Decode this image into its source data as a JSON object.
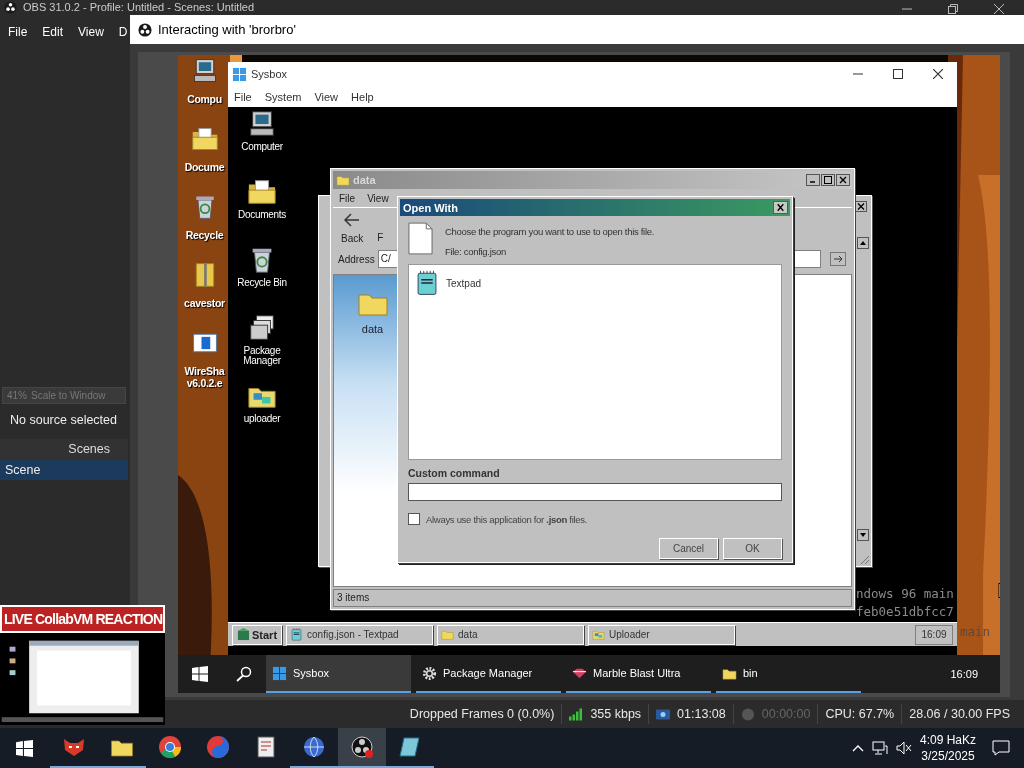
{
  "obs": {
    "title": "OBS 31.0.2 - Profile: Untitled - Scenes: Untitled",
    "menu": [
      "File",
      "Edit",
      "View",
      "D"
    ],
    "scale": {
      "percent": "41%",
      "label": "Scale to Window"
    },
    "no_source": "No source selected",
    "scenes": {
      "header": "Scenes",
      "items": [
        {
          "label": "Scene",
          "selected": true
        }
      ]
    },
    "preview": {
      "banner": "LIVE CollabVM REACTION"
    }
  },
  "interact_window": {
    "title": "Interacting with 'brorbro'"
  },
  "host_desktop": {
    "icons": [
      {
        "label": "Compu",
        "kind": "computer"
      },
      {
        "label": "Docume",
        "kind": "documents"
      },
      {
        "label": "Recycle",
        "kind": "recycle"
      },
      {
        "label": "cavestor",
        "kind": "zip"
      },
      {
        "label": "WireSha v6.0.2.e",
        "kind": "installer"
      }
    ],
    "overlay_text": [
      "ndows 96 main",
      "feb0e51dbfcc7",
      "main"
    ]
  },
  "sysbox": {
    "title": "Sysbox",
    "menu": [
      "File",
      "System",
      "View",
      "Help"
    ],
    "desktop_icons": [
      {
        "label": "Computer",
        "kind": "computer"
      },
      {
        "label": "Documents",
        "kind": "documents"
      },
      {
        "label": "Recycle Bin",
        "kind": "recycle"
      },
      {
        "label": "Package Manager",
        "kind": "package"
      },
      {
        "label": "uploader",
        "kind": "uploader"
      }
    ],
    "explorer": {
      "title": "data",
      "menu": [
        "File",
        "View"
      ],
      "back": "Back",
      "forward": "F",
      "address_label": "Address",
      "address": "C/",
      "items": [
        {
          "label": "data",
          "kind": "folder"
        }
      ],
      "status": "3 items"
    },
    "open_with": {
      "title": "Open With",
      "prompt": "Choose the program you want to use to open this file.",
      "file": "File: config.json",
      "programs": [
        {
          "label": "Textpad",
          "kind": "textpad",
          "selected": false
        }
      ],
      "custom_label": "Custom command",
      "always": {
        "label": "Always use this application for **.json** files.",
        "checked": false
      },
      "buttons": [
        "Cancel",
        "OK"
      ]
    },
    "taskbar": {
      "start": "Start",
      "tasks": [
        {
          "label": "config.json - Textpad",
          "kind": "textpad"
        },
        {
          "label": "data",
          "kind": "folder"
        },
        {
          "label": "Uploader",
          "kind": "uploader"
        }
      ],
      "clock": "16:09"
    }
  },
  "vm_taskbar": {
    "tasks": [
      {
        "label": "Sysbox",
        "kind": "windows",
        "selected": true
      },
      {
        "label": "Package Manager",
        "kind": "gear",
        "selected": false
      },
      {
        "label": "Marble Blast Ultra",
        "kind": "marble",
        "selected": false
      },
      {
        "label": "bin",
        "kind": "folder",
        "selected": false
      }
    ],
    "clock": "16:09"
  },
  "status_bar": {
    "dropped": "Dropped Frames 0 (0.0%)",
    "bitrate": "355 kbps",
    "stream_time": "01:13:08",
    "record_time": "00:00:00",
    "recording": false,
    "cpu": "CPU: 67.7%",
    "fps": "28.06 / 30.00 FPS"
  },
  "taskbar": {
    "apps": [
      {
        "kind": "mask",
        "running": true,
        "selected": false
      },
      {
        "kind": "folder",
        "running": true,
        "selected": false
      },
      {
        "kind": "ring",
        "running": false,
        "selected": false
      },
      {
        "kind": "swirl",
        "running": false,
        "selected": false
      },
      {
        "kind": "document",
        "running": false,
        "selected": false
      },
      {
        "kind": "globe",
        "running": true,
        "selected": false
      },
      {
        "kind": "obs",
        "running": true,
        "selected": true
      },
      {
        "kind": "crystal",
        "running": true,
        "selected": false
      }
    ],
    "time": "4:09 HaKz",
    "date": "3/25/2025"
  }
}
